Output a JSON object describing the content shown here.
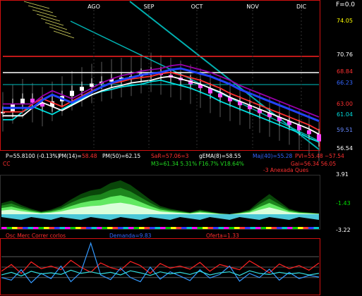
{
  "chart_data": [
    {
      "type": "line",
      "panel": "price",
      "x_tick_labels": [
        "AGO",
        "SEP",
        "OCT",
        "NOV",
        "DIC"
      ],
      "corner_label": "F=0.0",
      "right_axis_labels": [
        "74.05",
        "70.76",
        "68.84",
        "66.23",
        "63.00",
        "61.04",
        "59.51",
        "56.54"
      ],
      "ylim": [
        55.5,
        76.5
      ],
      "bar_color_up": "#ffffff",
      "bar_color_down": "#ff44ff",
      "ma_colors": [
        "#00e0e0",
        "#ffffff",
        "#ff3030",
        "#2244ff",
        "#9900aa"
      ],
      "close_series_approx": [
        61.0,
        62.2,
        63.0,
        62.4,
        61.8,
        62.6,
        63.4,
        64.2,
        64.8,
        65.3,
        65.6,
        66.0,
        66.2,
        66.4,
        66.8,
        67.0,
        66.6,
        66.2,
        65.8,
        65.2,
        64.6,
        63.8,
        63.2,
        62.6,
        62.0,
        61.4,
        60.8,
        60.2,
        59.6,
        59.0,
        58.2,
        57.6,
        56.5
      ],
      "info_row_1": {
        "price": "P=55.8100 (-0.13%)",
        "pm14_label": "PM(14)=",
        "pm14_value": "58.48",
        "pm50": "PM(50)=62.15",
        "sar": "SaR=57.06=3",
        "gema": "gEMA(8)=58.55",
        "maj": "Maj(40)=55.28",
        "pvi": "PVI=55.48 ~57.54"
      },
      "info_row_2": {
        "left_label": "CC",
        "m3": "M3=61.34 5.31% F16.7% V18.64%",
        "gai": "Gai=56.34 56.05"
      }
    },
    {
      "type": "area",
      "panel": "oscillator",
      "title": "-3 Anexada Ques",
      "right_axis_labels": [
        "3.91",
        "-1.43",
        "-3.22"
      ],
      "colors": [
        "#0a4a0a",
        "#1f8a1f",
        "#66ee66",
        "#e0ffe0"
      ],
      "values_approx": [
        1.2,
        1.5,
        1.0,
        0.6,
        0.3,
        0.5,
        0.9,
        1.6,
        2.2,
        2.6,
        2.8,
        3.4,
        3.7,
        3.2,
        2.4,
        1.6,
        0.9,
        0.6,
        0.4,
        0.2,
        0.5,
        0.3,
        0.1,
        0.0,
        0.2,
        0.5,
        1.4,
        2.2,
        1.4,
        0.6,
        0.3,
        0.2,
        0.1
      ]
    },
    {
      "type": "line",
      "panel": "momentum",
      "labels": [
        "Osc Merc Correr corlos",
        "Demanda=9.83",
        "Oferta=1.33"
      ],
      "series": [
        {
          "color": "#ff2222",
          "values": [
            42,
            55,
            38,
            60,
            47,
            52,
            45,
            63,
            50,
            40,
            58,
            49,
            44,
            61,
            53,
            38,
            57,
            48,
            52,
            46,
            59,
            42,
            55,
            50,
            45,
            62,
            51,
            39,
            56,
            47,
            53,
            44,
            58
          ]
        },
        {
          "color": "#3399ff",
          "values": [
            30,
            25,
            45,
            20,
            38,
            28,
            52,
            22,
            40,
            96,
            35,
            26,
            48,
            30,
            22,
            50,
            27,
            41,
            33,
            24,
            45,
            29,
            36,
            52,
            23,
            38,
            30,
            46,
            25,
            40,
            28,
            34,
            31
          ]
        },
        {
          "color": "#33dddd",
          "values": [
            35,
            40,
            33,
            42,
            37,
            39,
            36,
            44,
            38,
            41,
            37,
            40,
            35,
            43,
            39,
            34,
            41,
            37,
            40,
            36,
            42,
            35,
            39,
            41,
            34,
            43,
            38,
            36,
            40,
            37,
            39,
            35,
            38
          ]
        }
      ],
      "ylim": [
        0,
        100
      ]
    }
  ]
}
